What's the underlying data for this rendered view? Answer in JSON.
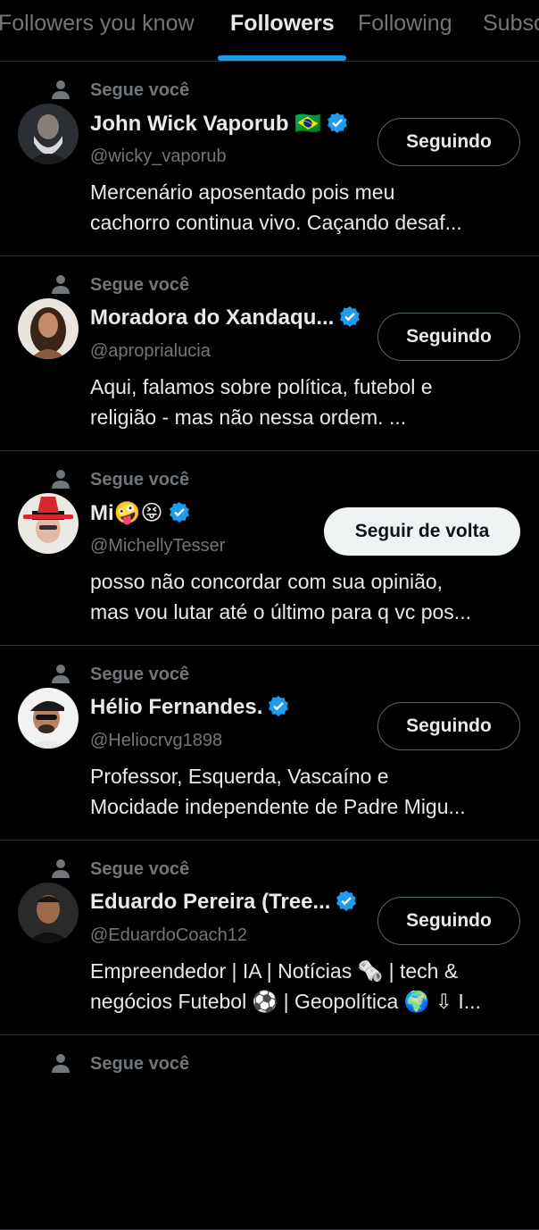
{
  "tabs": [
    {
      "label": "Followers you know",
      "active": false
    },
    {
      "label": "Followers",
      "active": true
    },
    {
      "label": "Following",
      "active": false
    },
    {
      "label": "Subsc",
      "active": false
    }
  ],
  "colors": {
    "accent": "#1d9bf0",
    "verified": "#1d9bf0",
    "muted": "#71767b"
  },
  "users": [
    {
      "context": "Segue você",
      "name": "John Wick Vaporub 🇧🇷",
      "verified": true,
      "handle": "@wicky_vaporub",
      "bio": [
        "Mercenário aposentado pois meu",
        "cachorro continua vivo. Caçando desaf..."
      ],
      "button": "Seguindo",
      "button_kind": "following",
      "avatar_icon": "bearded-man-avatar"
    },
    {
      "context": "Segue você",
      "name": "Moradora do Xandaqu...",
      "verified": true,
      "handle": "@aproprialucia",
      "bio": [
        "Aqui, falamos sobre política, futebol e",
        "religião - mas não nessa ordem. ..."
      ],
      "button": "Seguindo",
      "button_kind": "following",
      "avatar_icon": "woman-avatar"
    },
    {
      "context": "Segue você",
      "name": "Mi🤪😝",
      "verified": true,
      "handle": "@MichellyTesser",
      "bio": [
        "posso não concordar com sua opinião,",
        "mas vou lutar até o último para q vc pos..."
      ],
      "button": "Seguir de volta",
      "button_kind": "followback",
      "avatar_icon": "red-hat-avatar"
    },
    {
      "context": "Segue você",
      "name": "Hélio Fernandes.",
      "verified": true,
      "handle": "@Heliocrvg1898",
      "bio": [
        "Professor, Esquerda, Vascaíno e",
        "Mocidade independente de Padre Migu..."
      ],
      "button": "Seguindo",
      "button_kind": "following",
      "avatar_icon": "man-cap-avatar"
    },
    {
      "context": "Segue você",
      "name": "Eduardo Pereira (Tree...",
      "verified": true,
      "handle": "@EduardoCoach12",
      "bio": [
        "Empreendedor |  IA | Notícias 🗞️ | tech &",
        "negócios Futebol ⚽ | Geopolítica 🌍 ⇩ I..."
      ],
      "button": "Seguindo",
      "button_kind": "following",
      "avatar_icon": "man-avatar"
    },
    {
      "context": "Segue você"
    }
  ]
}
